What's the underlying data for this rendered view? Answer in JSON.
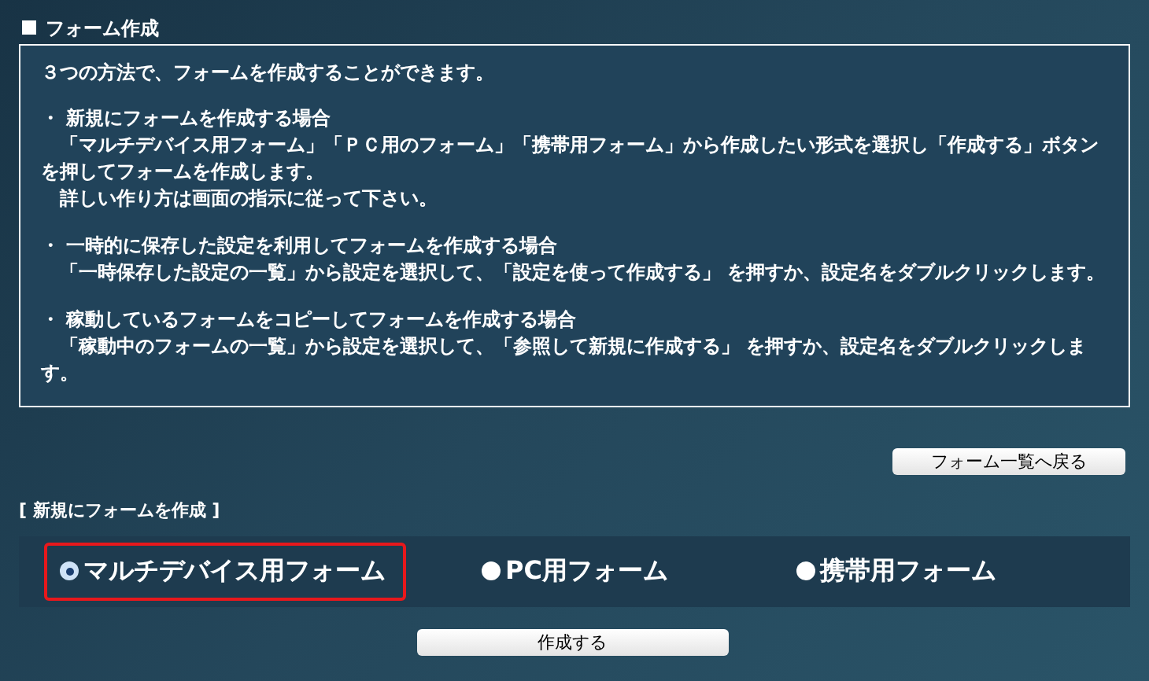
{
  "title": "フォーム作成",
  "info": {
    "intro": "３つの方法で、フォームを作成することができます。",
    "sections": [
      {
        "heading": "・ 新規にフォームを作成する場合",
        "paragraphs": [
          "「マルチデバイス用フォーム」「ＰＣ用のフォーム」「携帯用フォーム」から作成したい形式を選択し「作成する」ボタンを押してフォームを作成します。",
          "詳しい作り方は画面の指示に従って下さい。"
        ]
      },
      {
        "heading": "・ 一時的に保存した設定を利用してフォームを作成する場合",
        "paragraphs": [
          "「一時保存した設定の一覧」から設定を選択して、「設定を使って作成する」 を押すか、設定名をダブルクリックします。"
        ]
      },
      {
        "heading": "・ 稼動しているフォームをコピーしてフォームを作成する場合",
        "paragraphs": [
          "「稼動中のフォームの一覧」から設定を選択して、「参照して新規に作成する」 を押すか、設定名をダブルクリックします。"
        ]
      }
    ]
  },
  "back_button": "フォーム一覧へ戻る",
  "new_form": {
    "heading": "[ 新規にフォームを作成 ]",
    "options": [
      {
        "label": "マルチデバイス用フォーム",
        "selected": true,
        "highlighted": true
      },
      {
        "label": "PC用フォーム",
        "selected": false,
        "highlighted": false
      },
      {
        "label": "携帯用フォーム",
        "selected": false,
        "highlighted": false
      }
    ]
  },
  "create_button": "作成する"
}
